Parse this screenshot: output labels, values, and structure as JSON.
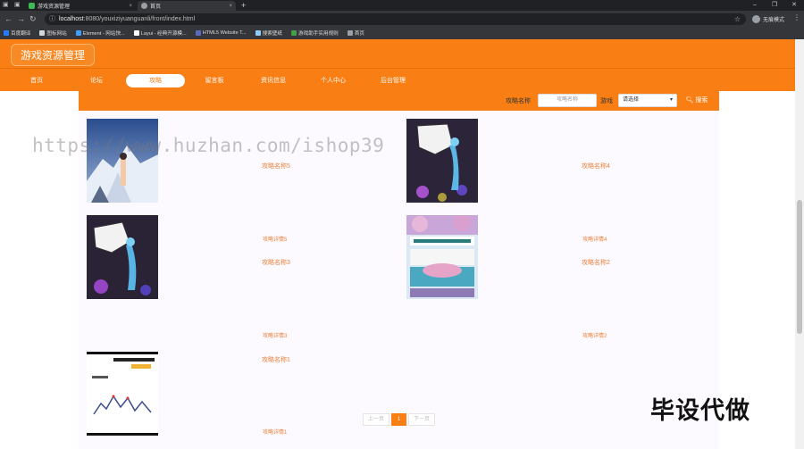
{
  "browser": {
    "tabs": [
      {
        "label": "游戏资源管理",
        "color": "#3cba54",
        "active": false
      },
      {
        "label": "首页",
        "color": "#9aa0a6",
        "active": true
      }
    ],
    "close_glyph": "×",
    "new_tab": "+",
    "window_controls": [
      "–",
      "❐",
      "✕"
    ],
    "url_host": "localhost",
    "url_rest": ":8080/youxiziyuanguanli/front/index.html",
    "profile_label": "无痕模式",
    "bookmarks": [
      {
        "label": "百度翻译",
        "color": "#2979ff"
      },
      {
        "label": "图标网站",
        "color": "#cfd8dc"
      },
      {
        "label": "Element - 网站快...",
        "color": "#409eff"
      },
      {
        "label": "Layui - 经典开源模...",
        "color": "#ffffff"
      },
      {
        "label": "HTML5 Website T...",
        "color": "#5c6bc0"
      },
      {
        "label": "搜索壁纸",
        "color": "#90caf9"
      },
      {
        "label": "游戏助手实用规则",
        "color": "#43a047"
      },
      {
        "label": "首页",
        "color": "#9aa0a6"
      }
    ]
  },
  "site": {
    "title": "游戏资源管理",
    "nav": [
      {
        "label": "首页",
        "active": false
      },
      {
        "label": "论坛",
        "active": false
      },
      {
        "label": "攻略",
        "active": true
      },
      {
        "label": "留言板",
        "active": false
      },
      {
        "label": "资讯信息",
        "active": false
      },
      {
        "label": "个人中心",
        "active": false
      },
      {
        "label": "后台管理",
        "active": false
      }
    ],
    "search": {
      "name_label": "攻略名称",
      "name_placeholder": "攻略名称",
      "game_label": "游戏",
      "game_selected": "请选择",
      "button_label": "搜索"
    },
    "cards": [
      {
        "title": "攻略名称5",
        "detail": "攻略详情5",
        "image": "snow-mountain"
      },
      {
        "title": "攻略名称4",
        "detail": "攻略详情4",
        "image": "night-figure-card"
      },
      {
        "title": "攻略名称3",
        "detail": "攻略详情3",
        "image": "night-figure-card"
      },
      {
        "title": "攻略名称2",
        "detail": "攻略详情2",
        "image": "blossom-poster"
      },
      {
        "title": "攻略名称1",
        "detail": "攻略详情1",
        "image": "travel-guide-doc"
      }
    ],
    "pagination": {
      "prev": "上一页",
      "current": "1",
      "next": "下一页"
    },
    "watermark": "https://www.huzhan.com/ishop39",
    "corner_text": "毕设代做"
  }
}
